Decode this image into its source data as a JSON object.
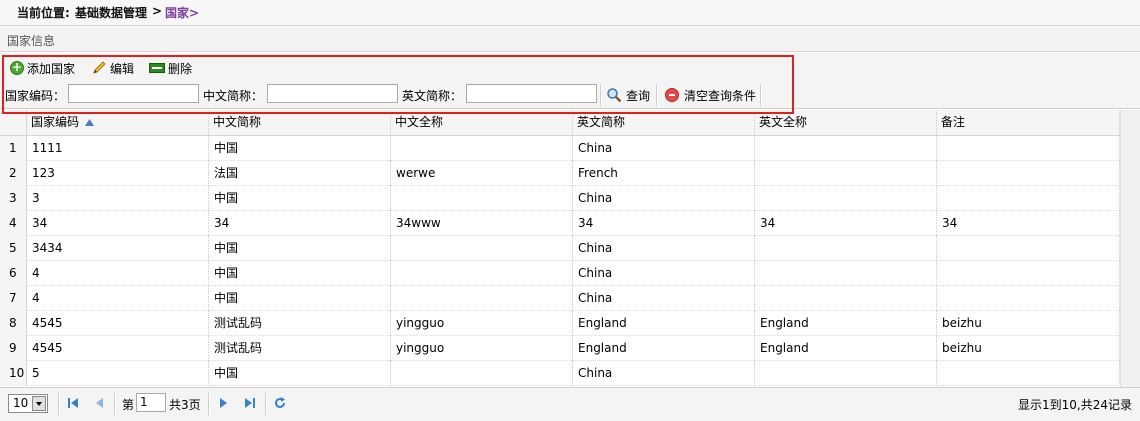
{
  "breadcrumb": {
    "prefix": "当前位置:",
    "section": "基础数据管理",
    "arrow1": ">",
    "current": "国家>"
  },
  "panel": {
    "title": "国家信息"
  },
  "toolbar": {
    "add_label": "添加国家",
    "edit_label": "编辑",
    "delete_label": "删除"
  },
  "search": {
    "code_label": "国家编码：",
    "code_value": "",
    "cn_label": "中文简称：",
    "cn_value": "",
    "en_label": "英文简称：",
    "en_value": "",
    "query_label": "查询",
    "clear_label": "清空查询条件"
  },
  "table": {
    "columns": [
      "国家编码",
      "中文简称",
      "中文全称",
      "英文简称",
      "英文全称",
      "备注"
    ],
    "rows": [
      {
        "num": "1",
        "code": "1111",
        "cn_short": "中国",
        "cn_full": "",
        "en_short": "China",
        "en_full": "",
        "remark": ""
      },
      {
        "num": "2",
        "code": "123",
        "cn_short": "法国",
        "cn_full": "werwe",
        "en_short": "French",
        "en_full": "",
        "remark": ""
      },
      {
        "num": "3",
        "code": "3",
        "cn_short": "中国",
        "cn_full": "",
        "en_short": "China",
        "en_full": "",
        "remark": ""
      },
      {
        "num": "4",
        "code": "34",
        "cn_short": "34",
        "cn_full": "34www",
        "en_short": "34",
        "en_full": "34",
        "remark": "34"
      },
      {
        "num": "5",
        "code": "3434",
        "cn_short": "中国",
        "cn_full": "",
        "en_short": "China",
        "en_full": "",
        "remark": ""
      },
      {
        "num": "6",
        "code": "4",
        "cn_short": "中国",
        "cn_full": "",
        "en_short": "China",
        "en_full": "",
        "remark": ""
      },
      {
        "num": "7",
        "code": "4",
        "cn_short": "中国",
        "cn_full": "",
        "en_short": "China",
        "en_full": "",
        "remark": ""
      },
      {
        "num": "8",
        "code": "4545",
        "cn_short": "测试乱码",
        "cn_full": "yingguo",
        "en_short": "England",
        "en_full": "England",
        "remark": "beizhu"
      },
      {
        "num": "9",
        "code": "4545",
        "cn_short": "测试乱码",
        "cn_full": "yingguo",
        "en_short": "England",
        "en_full": "England",
        "remark": "beizhu"
      },
      {
        "num": "10",
        "code": "5",
        "cn_short": "中国",
        "cn_full": "",
        "en_short": "China",
        "en_full": "",
        "remark": ""
      }
    ]
  },
  "pager": {
    "page_size": "10",
    "page_prefix": "第",
    "page_value": "1",
    "page_total": "共3页",
    "info": "显示1到10,共24记录"
  },
  "icons": {
    "add": "add-icon",
    "edit": "pencil-icon",
    "delete": "delete-icon",
    "query": "magnifier-icon",
    "clear": "minus-circle-icon",
    "sort": "sort-asc-icon",
    "first": "first-page-icon",
    "prev": "prev-page-icon",
    "next": "next-page-icon",
    "last": "last-page-icon",
    "refresh": "refresh-icon"
  },
  "colors": {
    "highlight_box": "#e02020",
    "breadcrumb_current": "#7b3f9c"
  }
}
